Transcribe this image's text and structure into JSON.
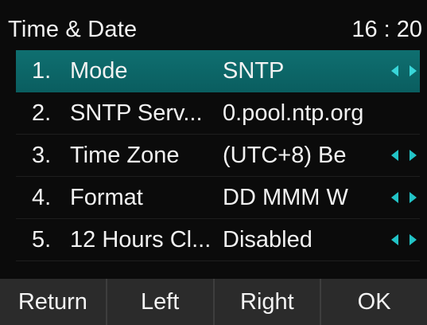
{
  "header": {
    "title": "Time & Date",
    "clock": "16 : 20"
  },
  "items": [
    {
      "index": "1.",
      "label": "Mode",
      "value": "SNTP",
      "has_arrows": true,
      "selected": true
    },
    {
      "index": "2.",
      "label": "SNTP Serv...",
      "value": "0.pool.ntp.org",
      "has_arrows": false,
      "selected": false
    },
    {
      "index": "3.",
      "label": "Time Zone",
      "value": "(UTC+8) Be",
      "has_arrows": true,
      "selected": false
    },
    {
      "index": "4.",
      "label": "Format",
      "value": "DD MMM W",
      "has_arrows": true,
      "selected": false
    },
    {
      "index": "5.",
      "label": "12 Hours Cl...",
      "value": "Disabled",
      "has_arrows": true,
      "selected": false
    }
  ],
  "softkeys": {
    "return": "Return",
    "left": "Left",
    "right": "Right",
    "ok": "OK"
  },
  "colors": {
    "selection": "#0a5e60",
    "arrow": "#22c3c6",
    "softkey_bar": "#2b2b2b",
    "background": "#0b0b0b"
  },
  "icons": {
    "left_arrow": "triangle-left-icon",
    "right_arrow": "triangle-right-icon"
  }
}
